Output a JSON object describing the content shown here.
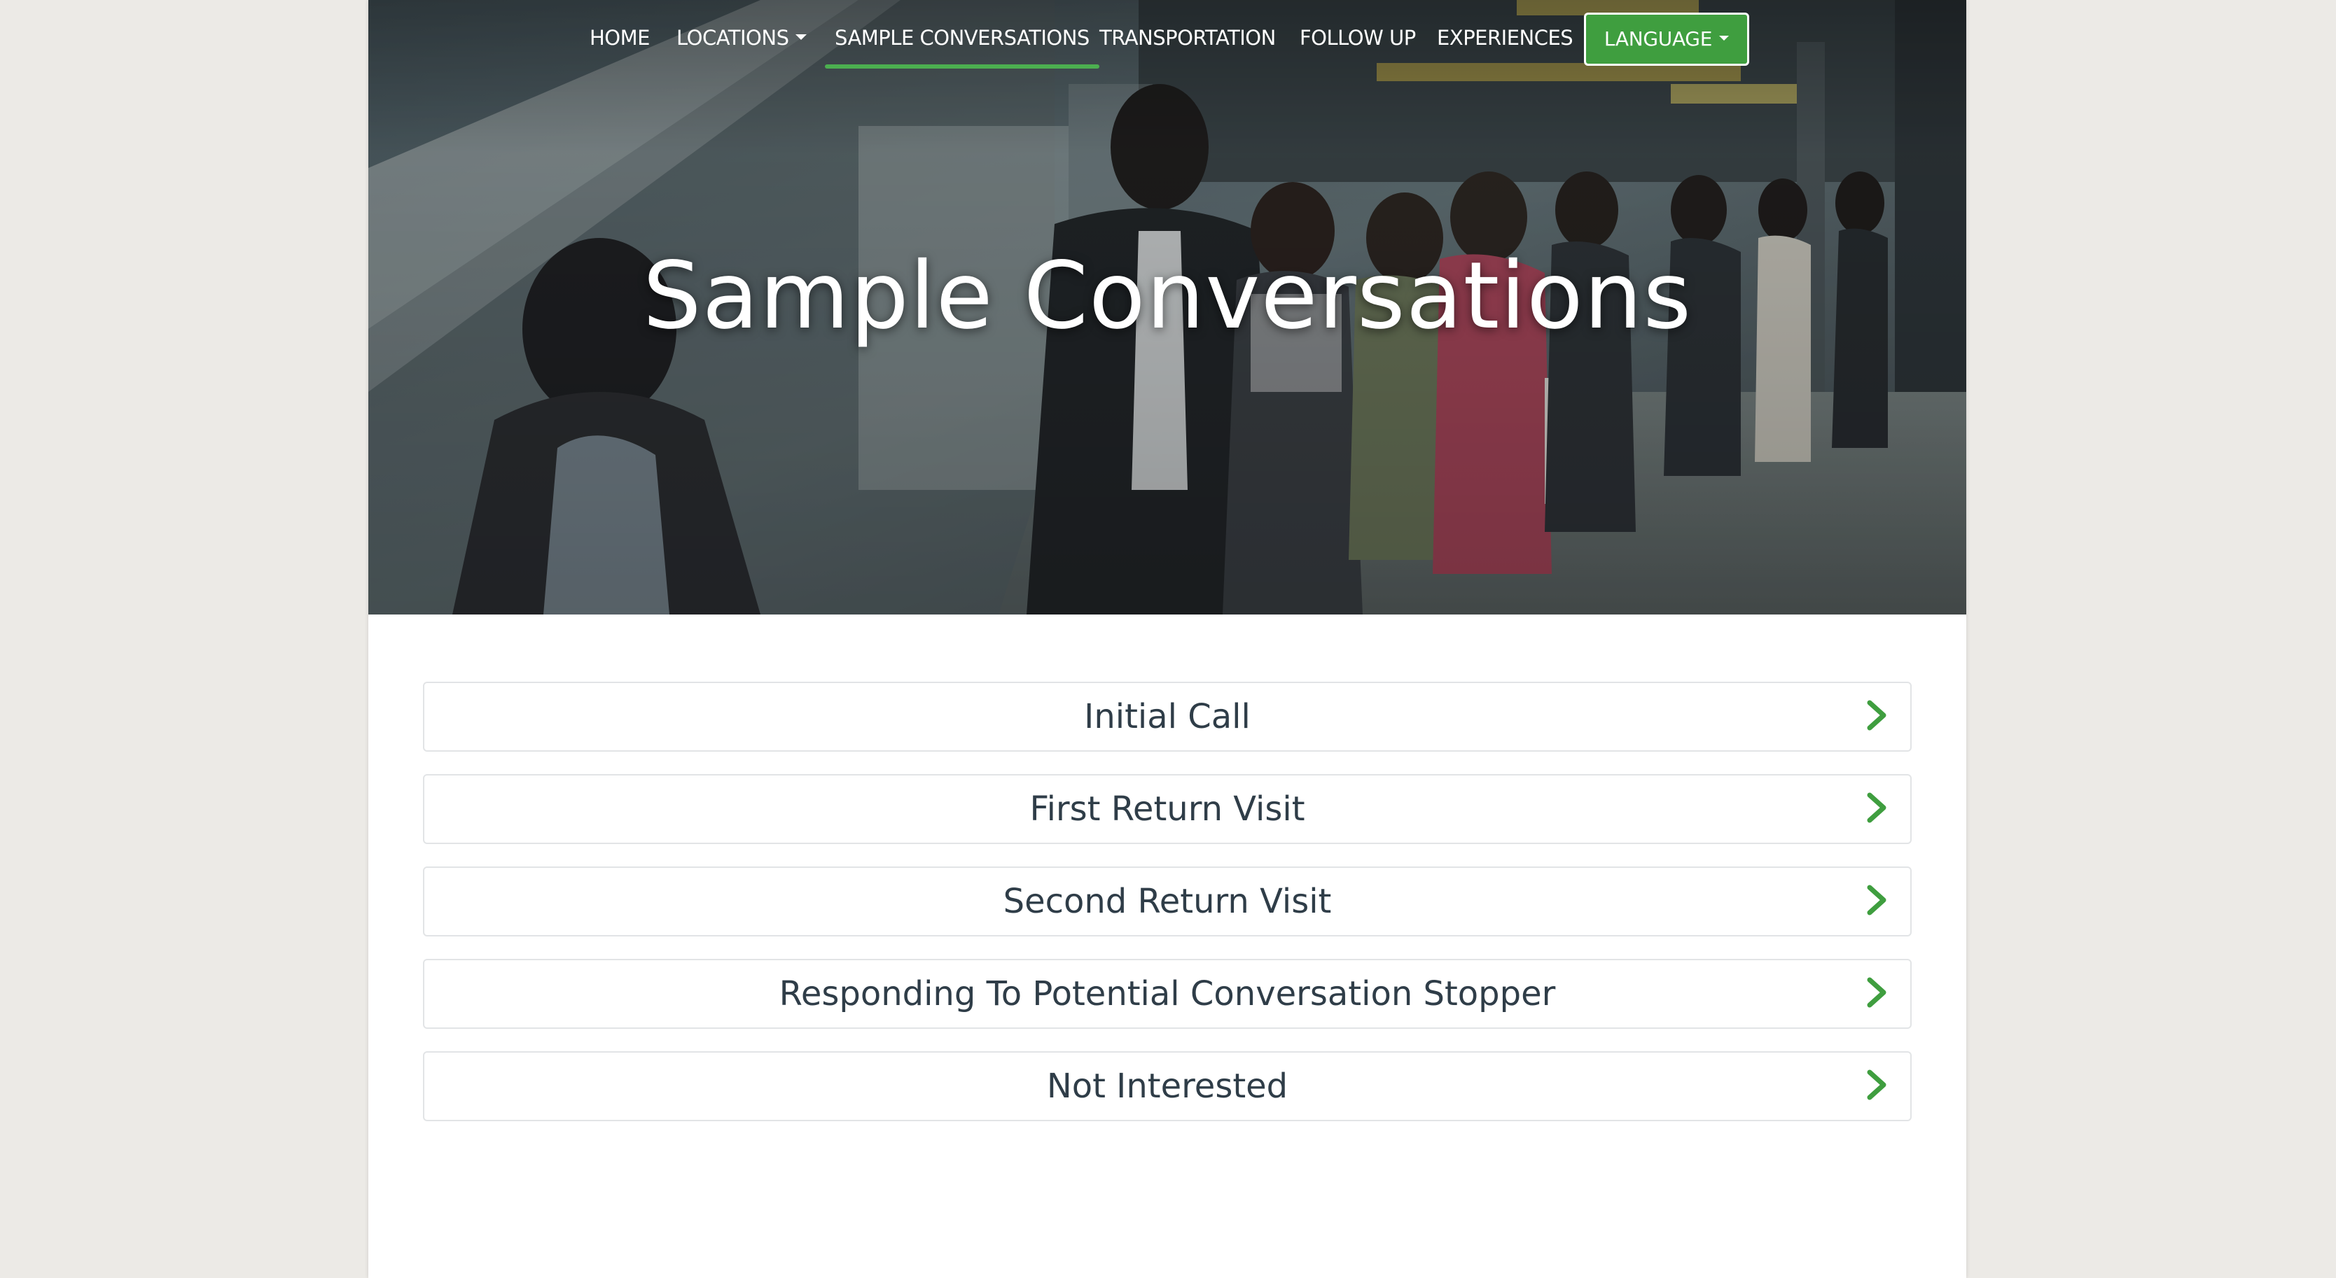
{
  "nav": {
    "items": [
      {
        "label": "HOME",
        "dropdown": false,
        "active": false
      },
      {
        "label": "LOCATIONS",
        "dropdown": true,
        "active": false
      },
      {
        "label": "SAMPLE CONVERSATIONS",
        "dropdown": false,
        "active": true
      },
      {
        "label": "TRANSPORTATION",
        "dropdown": false,
        "active": false
      },
      {
        "label": "FOLLOW UP",
        "dropdown": false,
        "active": false
      },
      {
        "label": "EXPERIENCES",
        "dropdown": false,
        "active": false
      }
    ],
    "language_label": "LANGUAGE"
  },
  "hero": {
    "title": "Sample Conversations",
    "image": "photo of people looking at phones on a train platform"
  },
  "accordion": {
    "items": [
      {
        "label": "Initial Call",
        "icon": "chevron-right-icon"
      },
      {
        "label": "First Return Visit",
        "icon": "chevron-right-icon"
      },
      {
        "label": "Second Return Visit",
        "icon": "chevron-right-icon"
      },
      {
        "label": "Responding To Potential Conversation Stopper",
        "icon": "chevron-right-icon"
      },
      {
        "label": "Not Interested",
        "icon": "chevron-right-icon"
      }
    ]
  },
  "colors": {
    "accent": "#3f9e3f",
    "chevron": "#3f9e3f",
    "text": "#2f3d48",
    "background": "#eceae6"
  }
}
